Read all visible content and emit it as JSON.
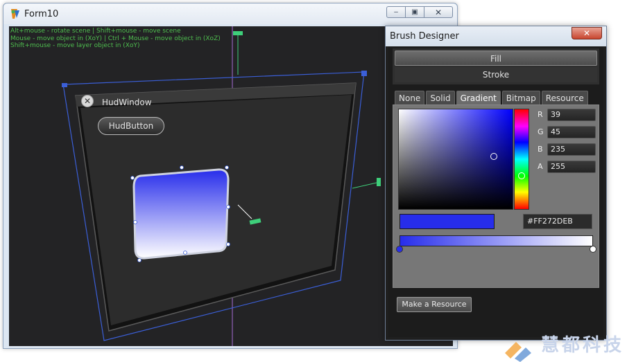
{
  "main_window": {
    "title": "Form10",
    "app_icon": "app-logo-icon",
    "caption_buttons": [
      "minimize-icon",
      "maximize-icon",
      "close-icon"
    ],
    "minimize_glyph": "–",
    "maximize_glyph": "▣",
    "close_glyph": "✕"
  },
  "viewport": {
    "help_lines": [
      "Alt+mouse - rotate scene | Shift+mouse - move scene",
      "Mouse - move object in (XoY) | Ctrl + Mouse - move object in (XoZ)",
      "Shift+mouse - move layer object in (XoY)"
    ],
    "hud_window": {
      "title": "HudWindow",
      "close_glyph": "✕",
      "button_label": "HudButton"
    },
    "gradient_rect": {
      "top_color": "#272deb",
      "bottom_color": "#ffffff"
    },
    "axis_colors": {
      "x": "#3ecf7a",
      "y": "#3ecf7a",
      "z": "#a76cd6",
      "selection": "#3b5fd8"
    }
  },
  "brush_designer": {
    "title": "Brush Designer",
    "close_glyph": "✕",
    "fill_label": "Fill",
    "stroke_label": "Stroke",
    "tabs": [
      "None",
      "Solid",
      "Gradient",
      "Bitmap",
      "Resource"
    ],
    "active_tab": "Gradient",
    "channels": [
      {
        "label": "R",
        "value": "39"
      },
      {
        "label": "G",
        "value": "45"
      },
      {
        "label": "B",
        "value": "235"
      },
      {
        "label": "A",
        "value": "255"
      }
    ],
    "hex_value": "#FF272DEB",
    "selected_color": "#272deb",
    "gradient_stops": [
      "#272deb",
      "#ffffff"
    ],
    "make_resource_label": "Make a Resource"
  },
  "watermark": {
    "text": "慧都科技"
  }
}
